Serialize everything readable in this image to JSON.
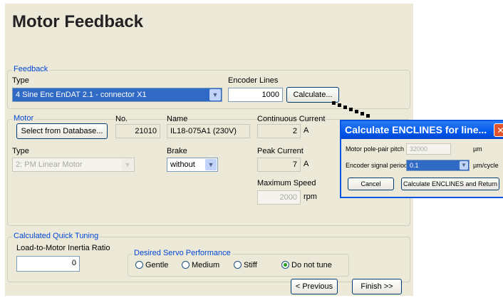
{
  "page": {
    "title": "Motor Feedback"
  },
  "feedback": {
    "legend": "Feedback",
    "type_label": "Type",
    "type_value": "4 Sine Enc EnDAT 2.1 - connector X1",
    "encoder_lines_label": "Encoder Lines",
    "encoder_lines_value": "1000",
    "calculate_button": "Calculate..."
  },
  "motor": {
    "legend": "Motor",
    "select_db_button": "Select from Database...",
    "no_label": "No.",
    "no_value": "21010",
    "name_label": "Name",
    "name_value": "IL18-075A1 (230V)",
    "cont_current_label": "Continuous Current",
    "cont_current_value": "2",
    "cont_current_unit": "A",
    "type_label": "Type",
    "type_value": "2: PM Linear Motor",
    "brake_label": "Brake",
    "brake_value": "without",
    "peak_current_label": "Peak Current",
    "peak_current_value": "7",
    "peak_current_unit": "A",
    "max_speed_label": "Maximum Speed",
    "max_speed_value": "2000",
    "max_speed_unit": "rpm"
  },
  "tuning": {
    "legend": "Calculated Quick Tuning",
    "inertia_label": "Load-to-Motor Inertia Ratio",
    "inertia_value": "0",
    "servo_legend": "Desired Servo Performance",
    "options": [
      "Gentle",
      "Medium",
      "Stiff",
      "Do not tune"
    ],
    "selected": "Do not tune"
  },
  "nav": {
    "previous_button": "< Previous",
    "finish_button": "Finish >>"
  },
  "dialog": {
    "title": "Calculate ENCLINES for line...",
    "pole_pitch_label": "Motor pole-pair pitch",
    "pole_pitch_value": "32000",
    "pole_pitch_unit": "µm",
    "signal_period_label": "Encoder signal period",
    "signal_period_value": "0.1",
    "signal_period_unit": "µm/cycle",
    "cancel_button": "Cancel",
    "calc_button": "Calculate ENCLINES and Return"
  }
}
